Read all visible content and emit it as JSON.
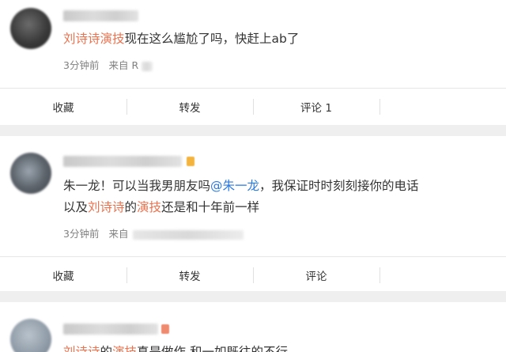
{
  "posts": [
    {
      "segments": [
        {
          "text": "刘诗诗演技",
          "style": "hl"
        },
        {
          "text": "现在这么尴尬了吗，快赶上ab了",
          "style": ""
        }
      ],
      "time": "3分钟前",
      "from_label": "来自",
      "from_visible": "R",
      "actions": {
        "favorite": "收藏",
        "repost": "转发",
        "comment": "评论 1"
      }
    },
    {
      "line1": [
        {
          "text": "朱一龙！可以当我男朋友吗",
          "style": ""
        },
        {
          "text": "@朱一龙",
          "style": "mention"
        },
        {
          "text": "，我保证时时刻刻接你的电话",
          "style": ""
        }
      ],
      "line2": [
        {
          "text": "以及",
          "style": ""
        },
        {
          "text": "刘诗诗",
          "style": "hl"
        },
        {
          "text": "的",
          "style": ""
        },
        {
          "text": "演技",
          "style": "hl"
        },
        {
          "text": "还是和十年前一样",
          "style": ""
        }
      ],
      "time": "3分钟前",
      "from_label": "来自",
      "actions": {
        "favorite": "收藏",
        "repost": "转发",
        "comment": "评论"
      }
    },
    {
      "partial": [
        {
          "text": "刘诗诗",
          "style": "hl"
        },
        {
          "text": "的",
          "style": ""
        },
        {
          "text": "演技",
          "style": "hl"
        },
        {
          "text": "真是做作 和一如既往的不行",
          "style": ""
        }
      ]
    }
  ],
  "colors": {
    "highlight": "#eb7350",
    "mention": "#2a7ae2",
    "meta": "#808080",
    "background": "#efefef"
  }
}
